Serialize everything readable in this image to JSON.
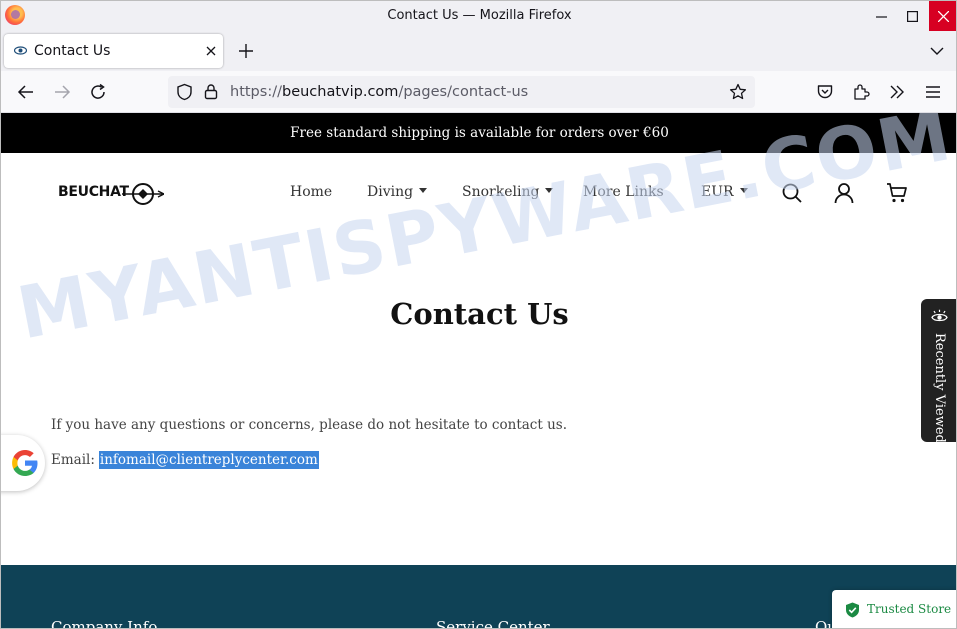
{
  "window": {
    "title": "Contact Us — Mozilla Firefox"
  },
  "tabs": [
    {
      "label": "Contact Us",
      "active": true
    }
  ],
  "url": {
    "scheme": "https://",
    "host": "beuchatvip.com",
    "path": "/pages/contact-us"
  },
  "announcement": "Free standard shipping is available for orders over €60",
  "header": {
    "logo_text": "BEUCHAT",
    "nav": [
      {
        "label": "Home",
        "has_dropdown": false
      },
      {
        "label": "Diving",
        "has_dropdown": true
      },
      {
        "label": "Snorkeling",
        "has_dropdown": true
      },
      {
        "label": "More Links",
        "has_dropdown": false
      }
    ],
    "currency": "EUR",
    "icons": [
      "search-icon",
      "account-icon",
      "cart-icon"
    ]
  },
  "main": {
    "title": "Contact Us",
    "intro": "If you have any questions or concerns, please do not hesitate to contact us.",
    "email_label": "Email:",
    "email": "infomail@clientreplycenter.com"
  },
  "watermark": "MYANTISPYWARE.COM",
  "recently_viewed": "Recently Viewed",
  "footer": {
    "columns": [
      "Company Info",
      "Service Center",
      "Ou"
    ]
  },
  "trusted_store": "Trusted Store",
  "colors": {
    "announcement_bg": "#000000",
    "footer_bg": "#0f4256",
    "selection": "#3a84d9",
    "trusted_green": "#1b8a43",
    "close_button": "#d70022"
  }
}
